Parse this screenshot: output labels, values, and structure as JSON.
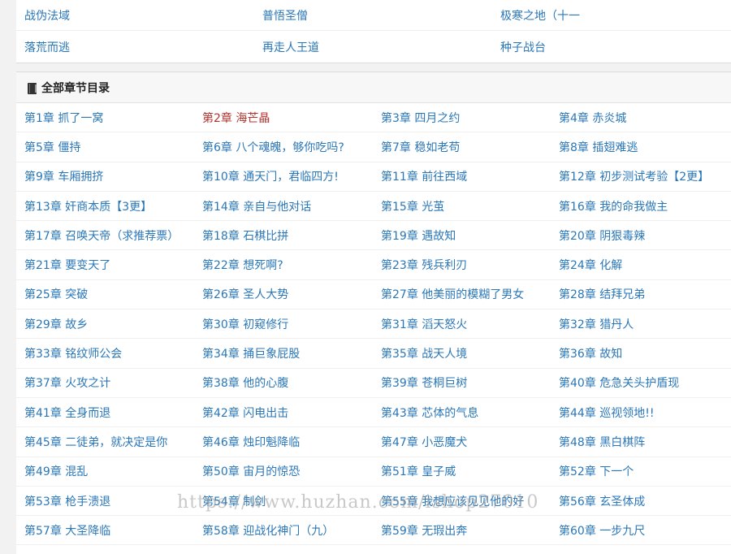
{
  "related": [
    "战伪法域",
    "普悟圣僧",
    "极寒之地（十一",
    "落荒而逃",
    "再走人王道",
    "种子战台"
  ],
  "section": {
    "title": "全部章节目录",
    "icon": "book-icon"
  },
  "current_index": 1,
  "chapters": [
    "第1章 抓了一窝",
    "第2章 海芒晶",
    "第3章 四月之约",
    "第4章 赤炎城",
    "第5章 僵持",
    "第6章 八个魂魄，够你吃吗?",
    "第7章 稳如老苟",
    "第8章 插翅难逃",
    "第9章 车厢拥挤",
    "第10章 通天门，君临四方!",
    "第11章 前往西域",
    "第12章 初步测试考验【2更】",
    "第13章 奸商本质【3更】",
    "第14章 亲自与他对话",
    "第15章 光茧",
    "第16章 我的命我做主",
    "第17章 召唤天帝（求推荐票）",
    "第18章 石棋比拼",
    "第19章 遇故知",
    "第20章 阴狠毒辣",
    "第21章 要变天了",
    "第22章 想死啊?",
    "第23章 残兵利刃",
    "第24章 化解",
    "第25章 突破",
    "第26章 圣人大势",
    "第27章 他美丽的模糊了男女",
    "第28章 结拜兄弟",
    "第29章 故乡",
    "第30章 初窥修行",
    "第31章 滔天怒火",
    "第32章 猎丹人",
    "第33章 铭纹师公会",
    "第34章 捅巨象屁股",
    "第35章 战天人境",
    "第36章 故知",
    "第37章 火攻之计",
    "第38章 他的心腹",
    "第39章 苍桐巨树",
    "第40章 危急关头护盾现",
    "第41章 全身而退",
    "第42章 闪电出击",
    "第43章 芯体的气息",
    "第44章 巡视领地!!",
    "第45章 二徒弟，就决定是你",
    "第46章 烛印魁降临",
    "第47章 小恶魔犬",
    "第48章 黑白棋阵",
    "第49章 混乱",
    "第50章 宙月的惊恐",
    "第51章 皇子威",
    "第52章 下一个",
    "第53章 枪手溃退",
    "第54章 制剑",
    "第55章 我想应该见见他的好",
    "第56章 玄圣体成",
    "第57章 大圣降临",
    "第58章 迎战化神门（九）",
    "第59章 无瑕出奔",
    "第60章 一步九尺"
  ],
  "watermark": "https://www.huzhan.com/ishop27010",
  "colors": {
    "link": "#2a77b8",
    "current": "#b3322c",
    "background": "#f2f2f2"
  }
}
